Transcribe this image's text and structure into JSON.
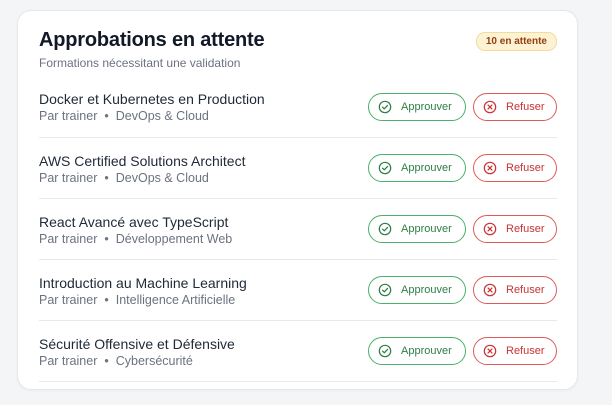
{
  "header": {
    "title": "Approbations en attente",
    "subtitle": "Formations nécessitant une validation",
    "badge": "10 en attente"
  },
  "actions": {
    "approve_label": "Approuver",
    "reject_label": "Refuser",
    "approve_icon": "check-circle-icon",
    "reject_icon": "x-circle-icon"
  },
  "items": [
    {
      "title": "Docker et Kubernetes en Production",
      "author": "Par trainer",
      "separator": "•",
      "category": "DevOps & Cloud"
    },
    {
      "title": "AWS Certified Solutions Architect",
      "author": "Par trainer",
      "separator": "•",
      "category": "DevOps & Cloud"
    },
    {
      "title": "React Avancé avec TypeScript",
      "author": "Par trainer",
      "separator": "•",
      "category": "Développement Web"
    },
    {
      "title": "Introduction au Machine Learning",
      "author": "Par trainer",
      "separator": "•",
      "category": "Intelligence Artificielle"
    },
    {
      "title": "Sécurité Offensive et Défensive",
      "author": "Par trainer",
      "separator": "•",
      "category": "Cybersécurité"
    }
  ],
  "colors": {
    "approve": "#2e7d46",
    "reject": "#c73333",
    "badge_bg": "#fdf3d4",
    "badge_text": "#92400e"
  }
}
